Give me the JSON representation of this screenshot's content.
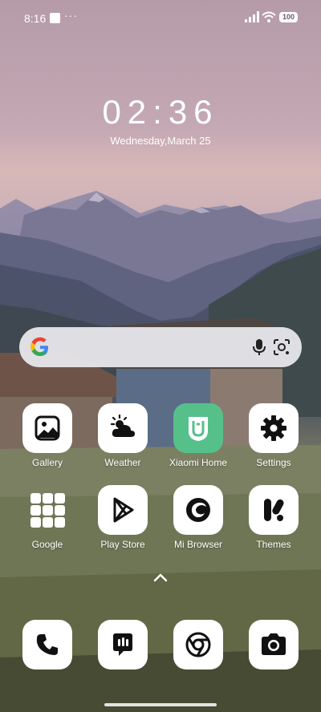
{
  "status_bar": {
    "time": "8:16",
    "dots": "···",
    "battery": "100",
    "icons": [
      "notification-square-icon",
      "signal-icon",
      "wifi-icon",
      "battery-icon"
    ]
  },
  "clock": {
    "time": "02:36",
    "date": "Wednesday,March 25"
  },
  "search": {
    "icons": [
      "google-g-icon",
      "mic-icon",
      "lens-icon"
    ]
  },
  "apps": {
    "row1": [
      {
        "label": "Gallery",
        "icon": "gallery-icon"
      },
      {
        "label": "Weather",
        "icon": "weather-icon"
      },
      {
        "label": "Xiaomi Home",
        "icon": "xiaomi-home-icon",
        "color": "#56c08b"
      },
      {
        "label": "Settings",
        "icon": "gear-icon"
      }
    ],
    "row2": [
      {
        "label": "Google",
        "icon": "google-folder-icon"
      },
      {
        "label": "Play Store",
        "icon": "play-store-icon"
      },
      {
        "label": "Mi Browser",
        "icon": "mi-browser-icon"
      },
      {
        "label": "Themes",
        "icon": "themes-icon"
      }
    ]
  },
  "dock": [
    {
      "icon": "phone-icon"
    },
    {
      "icon": "messages-icon"
    },
    {
      "icon": "chrome-icon"
    },
    {
      "icon": "camera-icon"
    }
  ]
}
